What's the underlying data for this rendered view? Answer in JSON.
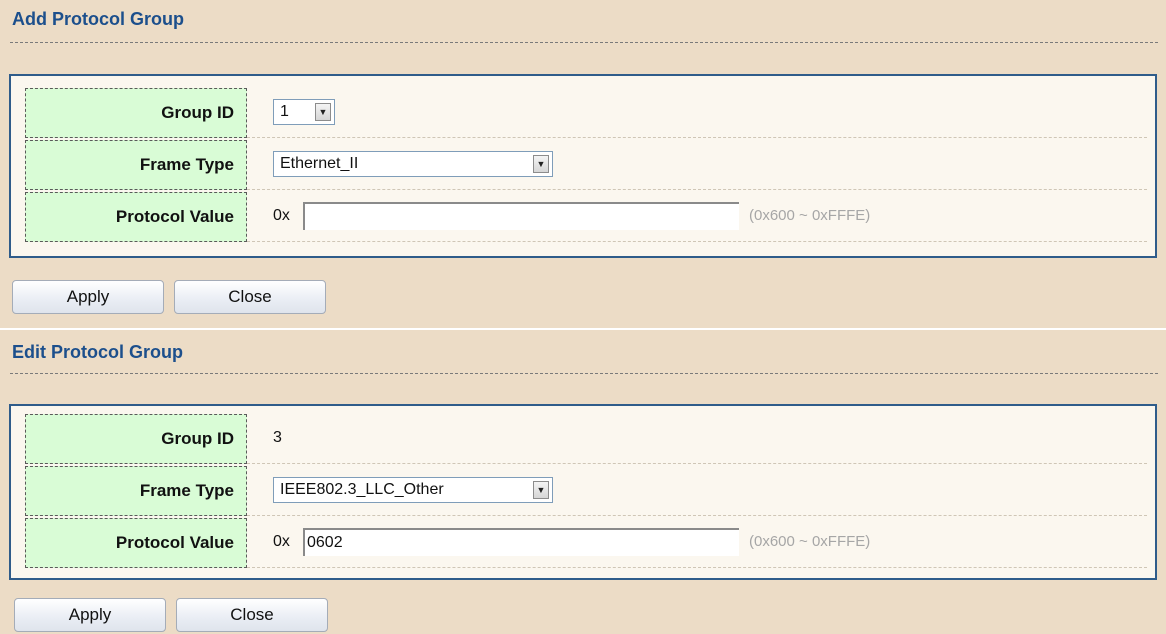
{
  "add_group": {
    "title": "Add Protocol Group",
    "group_id": {
      "label": "Group ID",
      "selected": "1"
    },
    "frame_type": {
      "label": "Frame Type",
      "selected": "Ethernet_II"
    },
    "protocol_value": {
      "label": "Protocol Value",
      "prefix": "0x",
      "value": "",
      "hint": "(0x600 ~ 0xFFFE)"
    },
    "buttons": {
      "apply": "Apply",
      "close": "Close"
    }
  },
  "edit_group": {
    "title": "Edit Protocol Group",
    "group_id": {
      "label": "Group ID",
      "value": "3"
    },
    "frame_type": {
      "label": "Frame Type",
      "selected": "IEEE802.3_LLC_Other"
    },
    "protocol_value": {
      "label": "Protocol Value",
      "prefix": "0x",
      "value": "0602",
      "hint": "(0x600 ~ 0xFFFE)"
    },
    "buttons": {
      "apply": "Apply",
      "close": "Close"
    }
  },
  "icons": {
    "dropdown_arrow": "chevron-down-icon"
  },
  "colors": {
    "panel_background": "#ecdcc6",
    "title_text": "#1c4f8c",
    "label_cell": "#d9fcd6",
    "form_border": "#2f5c8a",
    "hint_text": "#a6a6a6"
  }
}
